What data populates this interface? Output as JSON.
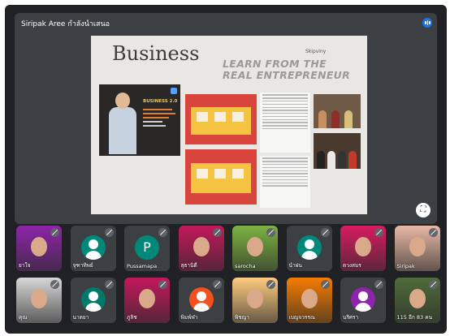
{
  "presenter": {
    "label": "Siripak Aree กำลังนำเสนอ"
  },
  "slide": {
    "title": "Business",
    "tagline_1": "LEARN FROM THE",
    "tagline_2": "REAL ENTREPRENEUR",
    "corner_tag": "Skipviny",
    "book_title": "BUSINESS 2.0"
  },
  "participants": [
    {
      "name": "ยาใจ",
      "avatar_color": "#8e24aa",
      "type": "photo"
    },
    {
      "name": "จุฑาทิพย์",
      "avatar_color": "#00897b",
      "type": "silhouette"
    },
    {
      "name": "Pussamapa",
      "avatar_color": "#00897b",
      "type": "letter",
      "letter": "P"
    },
    {
      "name": "สุธานิดี",
      "avatar_color": "#c2185b",
      "type": "photo"
    },
    {
      "name": "sarocha",
      "avatar_color": "#7cb342",
      "type": "photo"
    },
    {
      "name": "นำฝน",
      "avatar_color": "#00897b",
      "type": "silhouette"
    },
    {
      "name": "ดวงสมร",
      "avatar_color": "#d81b60",
      "type": "photo"
    },
    {
      "name": "Siripak",
      "avatar_color": "#e9b9a6",
      "type": "photo"
    },
    {
      "name": "คุณ",
      "avatar_color": "#d7d7d7",
      "type": "photo"
    },
    {
      "name": "นาตยา",
      "avatar_color": "#00796b",
      "type": "silhouette"
    },
    {
      "name": "ภูลิช",
      "avatar_color": "#c2185b",
      "type": "photo"
    },
    {
      "name": "พิมพ์ฬา",
      "avatar_color": "#f4511e",
      "type": "silhouette"
    },
    {
      "name": "พิชญา",
      "avatar_color": "#ffcc80",
      "type": "photo"
    },
    {
      "name": "เบญจวรรณ",
      "avatar_color": "#f57c00",
      "type": "photo"
    },
    {
      "name": "นริศรา",
      "avatar_color": "#8e24aa",
      "type": "silhouette"
    },
    {
      "name": "115  อีก 83 คน",
      "avatar_color": "#4e6b3a",
      "type": "photo"
    }
  ],
  "colors": {
    "background": "#202124",
    "tile": "#3c4043",
    "accent": "#1a73e8"
  },
  "icons": [
    "audio-level-icon",
    "fullscreen-icon",
    "mic-off-icon"
  ]
}
